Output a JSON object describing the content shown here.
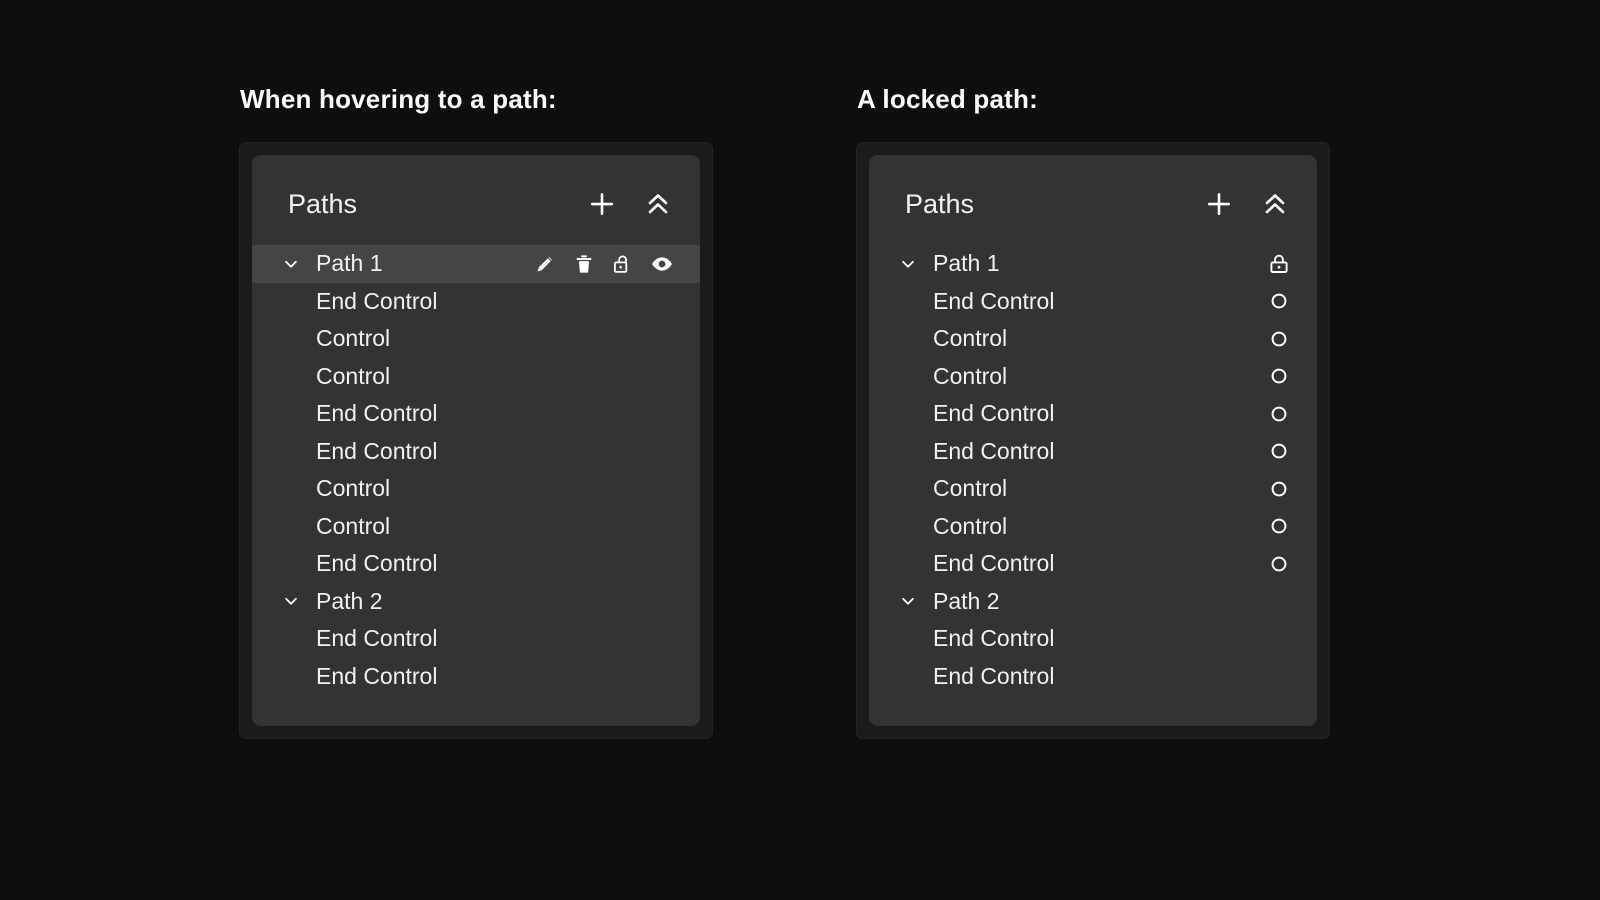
{
  "page": {
    "background_color": "#0e0e0e",
    "panel_background": "#333333",
    "frame_background": "#1b1b1b",
    "hover_row_color": "#454545",
    "text_color": "#f1f1f1"
  },
  "panels": [
    {
      "caption": "When hovering to a path:",
      "header": {
        "title": "Paths",
        "add_label": "add-path",
        "collapse_label": "collapse-all"
      },
      "rows": [
        {
          "label": "Path 1",
          "type": "path",
          "expanded": true,
          "hovered": true,
          "actions": [
            "edit-icon",
            "delete-icon",
            "unlock-icon",
            "visibility-icon"
          ]
        },
        {
          "label": "End Control",
          "type": "control",
          "expanded": false,
          "hovered": false,
          "actions": []
        },
        {
          "label": "Control",
          "type": "control",
          "expanded": false,
          "hovered": false,
          "actions": []
        },
        {
          "label": "Control",
          "type": "control",
          "expanded": false,
          "hovered": false,
          "actions": []
        },
        {
          "label": "End Control",
          "type": "control",
          "expanded": false,
          "hovered": false,
          "actions": []
        },
        {
          "label": "End Control",
          "type": "control",
          "expanded": false,
          "hovered": false,
          "actions": []
        },
        {
          "label": "Control",
          "type": "control",
          "expanded": false,
          "hovered": false,
          "actions": []
        },
        {
          "label": "Control",
          "type": "control",
          "expanded": false,
          "hovered": false,
          "actions": []
        },
        {
          "label": "End Control",
          "type": "control",
          "expanded": false,
          "hovered": false,
          "actions": []
        },
        {
          "label": "Path 2",
          "type": "path",
          "expanded": true,
          "hovered": false,
          "actions": []
        },
        {
          "label": "End Control",
          "type": "control",
          "expanded": false,
          "hovered": false,
          "actions": []
        },
        {
          "label": "End Control",
          "type": "control",
          "expanded": false,
          "hovered": false,
          "actions": []
        }
      ]
    },
    {
      "caption": "A locked path:",
      "header": {
        "title": "Paths",
        "add_label": "add-path",
        "collapse_label": "collapse-all"
      },
      "rows": [
        {
          "label": "Path 1",
          "type": "path",
          "expanded": true,
          "hovered": false,
          "actions": [
            "lock-icon"
          ]
        },
        {
          "label": "End Control",
          "type": "control",
          "expanded": false,
          "hovered": false,
          "actions": [
            "circle-icon"
          ]
        },
        {
          "label": "Control",
          "type": "control",
          "expanded": false,
          "hovered": false,
          "actions": [
            "circle-icon"
          ]
        },
        {
          "label": "Control",
          "type": "control",
          "expanded": false,
          "hovered": false,
          "actions": [
            "circle-icon"
          ]
        },
        {
          "label": "End Control",
          "type": "control",
          "expanded": false,
          "hovered": false,
          "actions": [
            "circle-icon"
          ]
        },
        {
          "label": "End Control",
          "type": "control",
          "expanded": false,
          "hovered": false,
          "actions": [
            "circle-icon"
          ]
        },
        {
          "label": "Control",
          "type": "control",
          "expanded": false,
          "hovered": false,
          "actions": [
            "circle-icon"
          ]
        },
        {
          "label": "Control",
          "type": "control",
          "expanded": false,
          "hovered": false,
          "actions": [
            "circle-icon"
          ]
        },
        {
          "label": "End Control",
          "type": "control",
          "expanded": false,
          "hovered": false,
          "actions": [
            "circle-icon"
          ]
        },
        {
          "label": "Path 2",
          "type": "path",
          "expanded": true,
          "hovered": false,
          "actions": []
        },
        {
          "label": "End Control",
          "type": "control",
          "expanded": false,
          "hovered": false,
          "actions": []
        },
        {
          "label": "End Control",
          "type": "control",
          "expanded": false,
          "hovered": false,
          "actions": []
        }
      ]
    }
  ]
}
